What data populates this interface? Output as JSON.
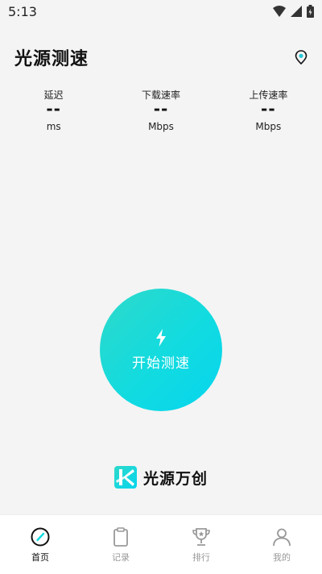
{
  "status_bar": {
    "time": "5:13"
  },
  "header": {
    "title": "光源测速"
  },
  "metrics": [
    {
      "label": "延迟",
      "value": "--",
      "unit": "ms"
    },
    {
      "label": "下载速率",
      "value": "--",
      "unit": "Mbps"
    },
    {
      "label": "上传速率",
      "value": "--",
      "unit": "Mbps"
    }
  ],
  "start_button": {
    "label": "开始测速"
  },
  "brand": {
    "name": "光源万创"
  },
  "tabs": [
    {
      "label": "首页",
      "icon": "speedometer-icon",
      "active": true
    },
    {
      "label": "记录",
      "icon": "clipboard-icon",
      "active": false
    },
    {
      "label": "排行",
      "icon": "trophy-icon",
      "active": false
    },
    {
      "label": "我的",
      "icon": "person-icon",
      "active": false
    }
  ],
  "colors": {
    "accent": "#12dbe0",
    "inactive": "#999999"
  }
}
